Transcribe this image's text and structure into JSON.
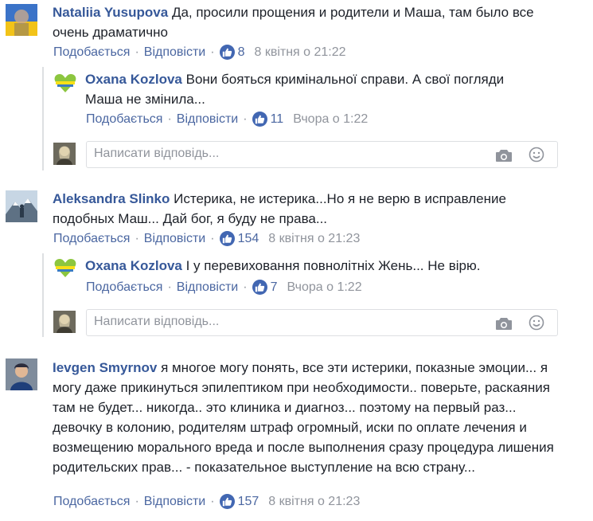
{
  "actions": {
    "like": "Подобається",
    "reply": "Відповісти",
    "reply_placeholder": "Написати відповідь..."
  },
  "comments": [
    {
      "author": "Nataliia Yusupova",
      "text": "Да, просили прощения и родители и Маша, там было все очень драматично",
      "likes": "8",
      "time": "8 квітня о 21:22",
      "replies": [
        {
          "author": "Oxana Kozlova",
          "text": "Вони бояться кримінальної справи. А свої погляди Маша не змінила...",
          "likes": "11",
          "time": "Вчора о 1:22"
        }
      ]
    },
    {
      "author": "Aleksandra Slinko",
      "text": "Истерика, не истерика...Но я не верю в исправление подобных Маш... Дай бог, я буду не права...",
      "likes": "154",
      "time": "8 квітня о 21:23",
      "replies": [
        {
          "author": "Oxana Kozlova",
          "text": "І у перевиховання повнолітніх Жень... Не вірю.",
          "likes": "7",
          "time": "Вчора о 1:22"
        }
      ]
    },
    {
      "author": "Ievgen Smyrnov",
      "text": "я многое могу понять, все эти истерики, показные эмоции... я могу даже прикинуться эпилептиком при необходимости.. поверьте, раскаяния там не будет... никогда.. это клиника и диагноз... поэтому на первый раз... девочку в колонию, родителям штраф огромный, иски по оплате лечения и возмещению морального вреда и после выполнения сразу процедура лишения родительских прав... - показательное выступление на всю страну...",
      "likes": "157",
      "time": "8 квітня о 21:23",
      "replies": []
    }
  ],
  "colors": {
    "link": "#365899",
    "meta": "#90949c",
    "like_blue": "#4267b2",
    "border": "#dddfe2"
  },
  "icons": [
    "like-thumb-icon",
    "camera-icon",
    "smiley-icon"
  ]
}
